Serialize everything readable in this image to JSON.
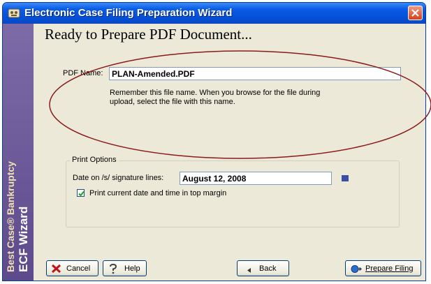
{
  "window": {
    "title": "Electronic Case Filing Preparation Wizard"
  },
  "sidebar": {
    "brand_line": "Best Case® Bankruptcy",
    "product_line": "ECF Wizard"
  },
  "main": {
    "heading": "Ready to Prepare PDF Document...",
    "pdf_name_label": "PDF Name:",
    "pdf_name_value": "PLAN-Amended.PDF",
    "note": "Remember this file name. When you browse for the file during upload, select the file with this name."
  },
  "print_options": {
    "group_title": "Print Options",
    "date_label": "Date on /s/ signature lines:",
    "date_value": "August 12, 2008",
    "print_date_label": "Print current date and time in top margin",
    "print_date_checked": true
  },
  "buttons": {
    "cancel": "Cancel",
    "help": "Help",
    "back": "Back",
    "prepare": "Prepare Filing"
  },
  "colors": {
    "titlebar": "#0450d8",
    "sidebar": "#5d4a8c",
    "annotation_ellipse": "#8b1a1a",
    "cancel_icon": "#c0131a"
  }
}
